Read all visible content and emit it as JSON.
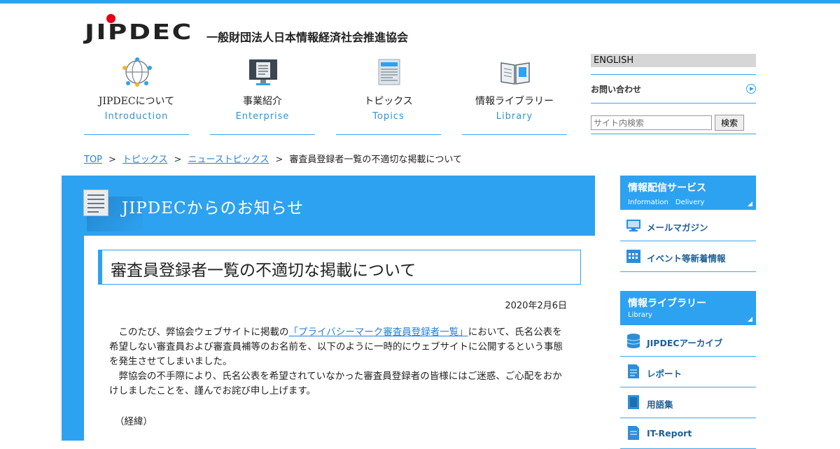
{
  "header": {
    "logo_text": "JIPDEC",
    "org_name": "一般財団法人日本情報経済社会推進協会"
  },
  "nav": [
    {
      "jp": "JIPDECについて",
      "en": "Introduction",
      "icon": "network-globe-icon"
    },
    {
      "jp": "事業紹介",
      "en": "Enterprise",
      "icon": "monitor-document-icon"
    },
    {
      "jp": "トピックス",
      "en": "Topics",
      "icon": "newspaper-icon"
    },
    {
      "jp": "情報ライブラリー",
      "en": "Library",
      "icon": "open-book-icon"
    }
  ],
  "utility": {
    "english": "ENGLISH",
    "contact": "お問い合わせ",
    "search_placeholder": "サイト内検索",
    "search_button": "検索"
  },
  "breadcrumb": {
    "items": [
      "TOP",
      "トピックス",
      "ニューストピックス"
    ],
    "current": "審査員登録者一覧の不適切な掲載について",
    "separator": ">"
  },
  "section": {
    "title": "JIPDECからのお知らせ"
  },
  "article": {
    "title": "審査員登録者一覧の不適切な掲載について",
    "date": "2020年2月6日",
    "para1_before": "　このたび、弊協会ウェブサイトに掲載の",
    "para1_link": "「プライバシーマーク審査員登録者一覧」",
    "para1_after": "において、氏名公表を希望しない審査員および審査員補等のお名前を、以下のように一時的にウェブサイトに公開するという事態を発生させてしまいました。",
    "para2": "　弊協会の不手際により、氏名公表を希望されていなかった審査員登録者の皆様にはご迷惑、ご心配をおかけしましたことを、謹んでお詫び申し上げます。",
    "keii": "（経緯）"
  },
  "sidebar": {
    "group1": {
      "title_jp": "情報配信サービス",
      "title_en": "Information　Delivery",
      "items": [
        {
          "label": "メールマガジン",
          "icon": "monitor-mail-icon"
        },
        {
          "label": "イベント等新着情報",
          "icon": "calendar-icon"
        }
      ]
    },
    "group2": {
      "title_jp": "情報ライブラリー",
      "title_en": "Library",
      "items": [
        {
          "label": "JIPDECアーカイブ",
          "icon": "database-icon"
        },
        {
          "label": "レポート",
          "icon": "report-document-icon"
        },
        {
          "label": "用語集",
          "icon": "glossary-book-icon"
        },
        {
          "label": "IT-Report",
          "icon": "it-report-document-icon"
        }
      ]
    }
  },
  "colors": {
    "accent": "#2da2f0",
    "link": "#2a7fd4",
    "logo_red": "#e50012"
  }
}
